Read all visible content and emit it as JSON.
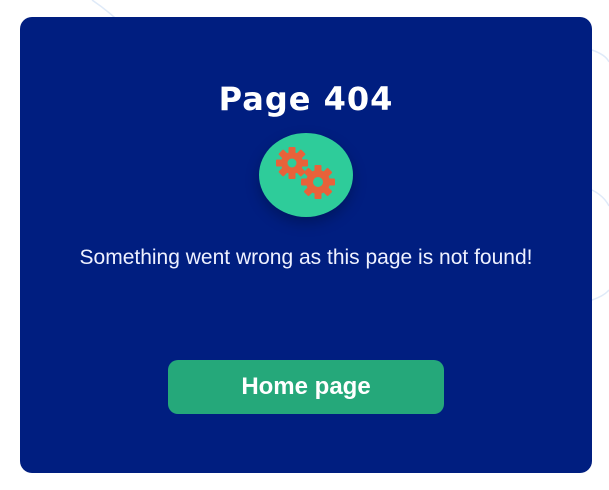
{
  "card": {
    "title": "Page 404",
    "message": "Something went wrong as this page is not found!",
    "icon": "gears-icon",
    "button_label": "Home page"
  },
  "colors": {
    "card_background": "#001e80",
    "icon_background": "#2ecc9a",
    "gear_color": "#e8623a",
    "button_background": "#25a87a",
    "text": "#ffffff"
  }
}
